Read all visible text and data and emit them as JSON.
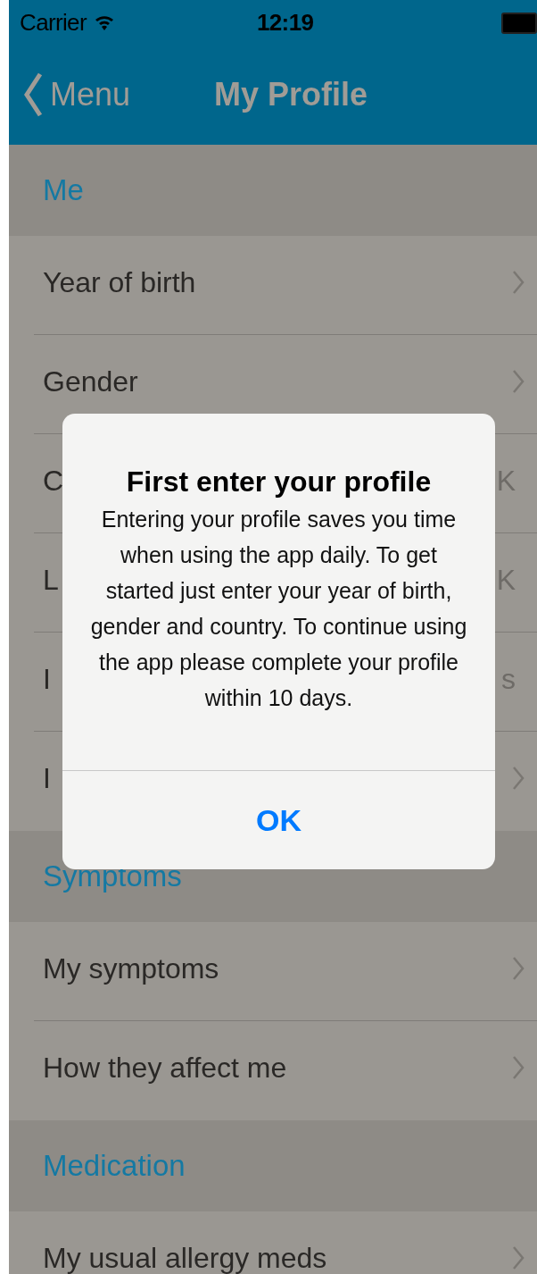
{
  "status_bar": {
    "carrier": "Carrier",
    "time": "12:19"
  },
  "nav_bar": {
    "back": "Menu",
    "title": "My Profile"
  },
  "sections": [
    {
      "header": "Me",
      "rows": [
        {
          "label": "Year of birth",
          "kind": "chevron"
        },
        {
          "label": "Gender",
          "kind": "chevron"
        },
        {
          "label": "C",
          "kind": "value",
          "value": "K"
        },
        {
          "label": "L",
          "kind": "value",
          "value": "K"
        },
        {
          "label": "I",
          "kind": "value",
          "value": "s"
        },
        {
          "label": "I",
          "kind": "chevron"
        }
      ]
    },
    {
      "header": "Symptoms",
      "rows": [
        {
          "label": "My symptoms",
          "kind": "chevron"
        },
        {
          "label": "How they affect me",
          "kind": "chevron"
        }
      ]
    },
    {
      "header": "Medication",
      "rows": [
        {
          "label": "My usual allergy meds",
          "kind": "chevron"
        }
      ]
    }
  ],
  "alert": {
    "title": "First enter your profile",
    "message": "Entering your profile saves you time when using the app daily. To get started just enter your year of birth, gender and country. To continue using the app please complete your profile within 10 days.",
    "button": "OK"
  }
}
